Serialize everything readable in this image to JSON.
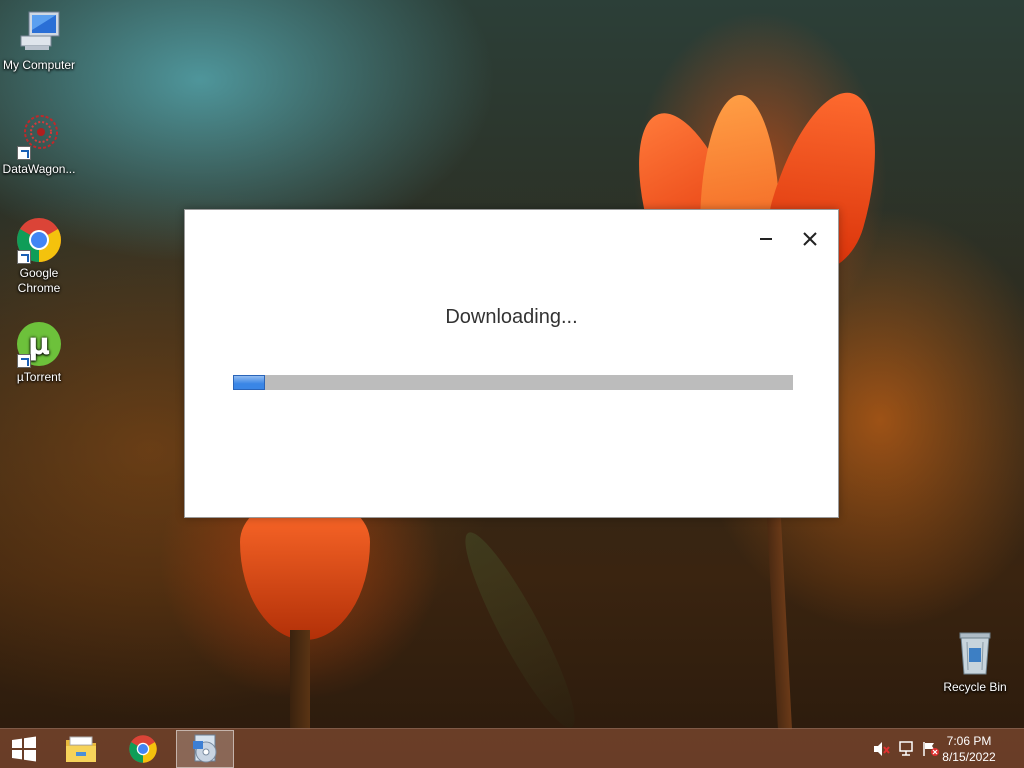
{
  "desktop": {
    "icons": [
      {
        "label": "My Computer",
        "icon": "computer-icon"
      },
      {
        "label": "DataWagon...",
        "icon": "datawagon-icon"
      },
      {
        "label": "Google Chrome",
        "icon": "chrome-icon"
      },
      {
        "label": "µTorrent",
        "icon": "utorrent-icon"
      },
      {
        "label": "Recycle Bin",
        "icon": "recycle-bin-icon"
      }
    ]
  },
  "dialog": {
    "title": "Downloading...",
    "progress": 0.057,
    "progress_color": "#3a86e6",
    "minimize_icon": "minimize-icon",
    "close_icon": "close-icon"
  },
  "taskbar": {
    "start_icon": "windows-start-icon",
    "pinned": [
      "file-explorer-icon",
      "chrome-icon",
      "installer-icon"
    ],
    "active": "installer-icon",
    "tray": [
      "volume-muted-icon",
      "network-icon",
      "action-center-flag-icon"
    ],
    "clock": {
      "time": "7:06 PM",
      "date": "8/15/2022"
    }
  }
}
